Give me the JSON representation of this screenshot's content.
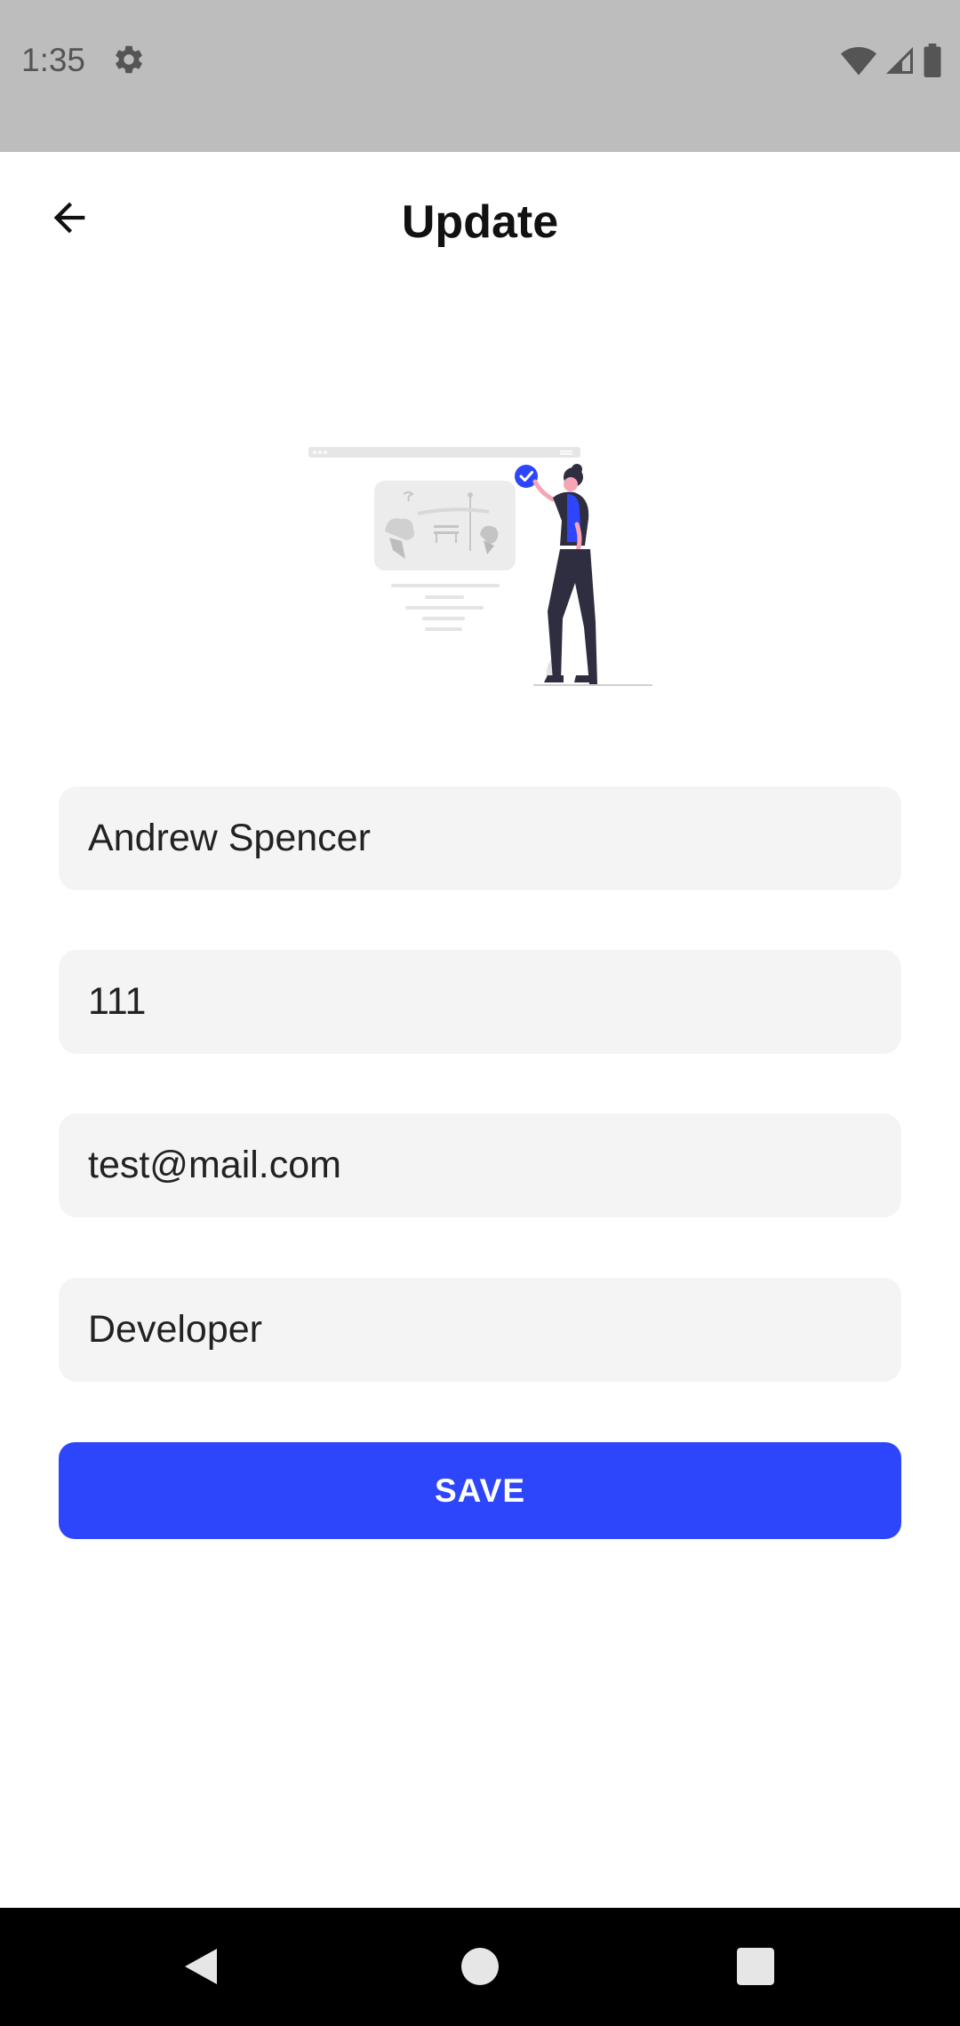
{
  "status_bar": {
    "time": "1:35"
  },
  "header": {
    "title": "Update"
  },
  "form": {
    "name_value": "Andrew Spencer",
    "id_value": "111",
    "email_value": "test@mail.com",
    "role_value": "Developer",
    "save_label": "SAVE"
  },
  "colors": {
    "accent": "#2d46fb",
    "field_bg": "#f4f4f4",
    "status_bar_bg": "#bdbdbd",
    "nav_bar_bg": "#000000"
  },
  "icons": {
    "back": "arrow-left-icon",
    "settings": "gear-icon",
    "wifi": "wifi-icon",
    "signal": "signal-icon",
    "battery": "battery-icon",
    "nav_back": "triangle-back-icon",
    "nav_home": "circle-home-icon",
    "nav_recents": "square-recents-icon"
  }
}
